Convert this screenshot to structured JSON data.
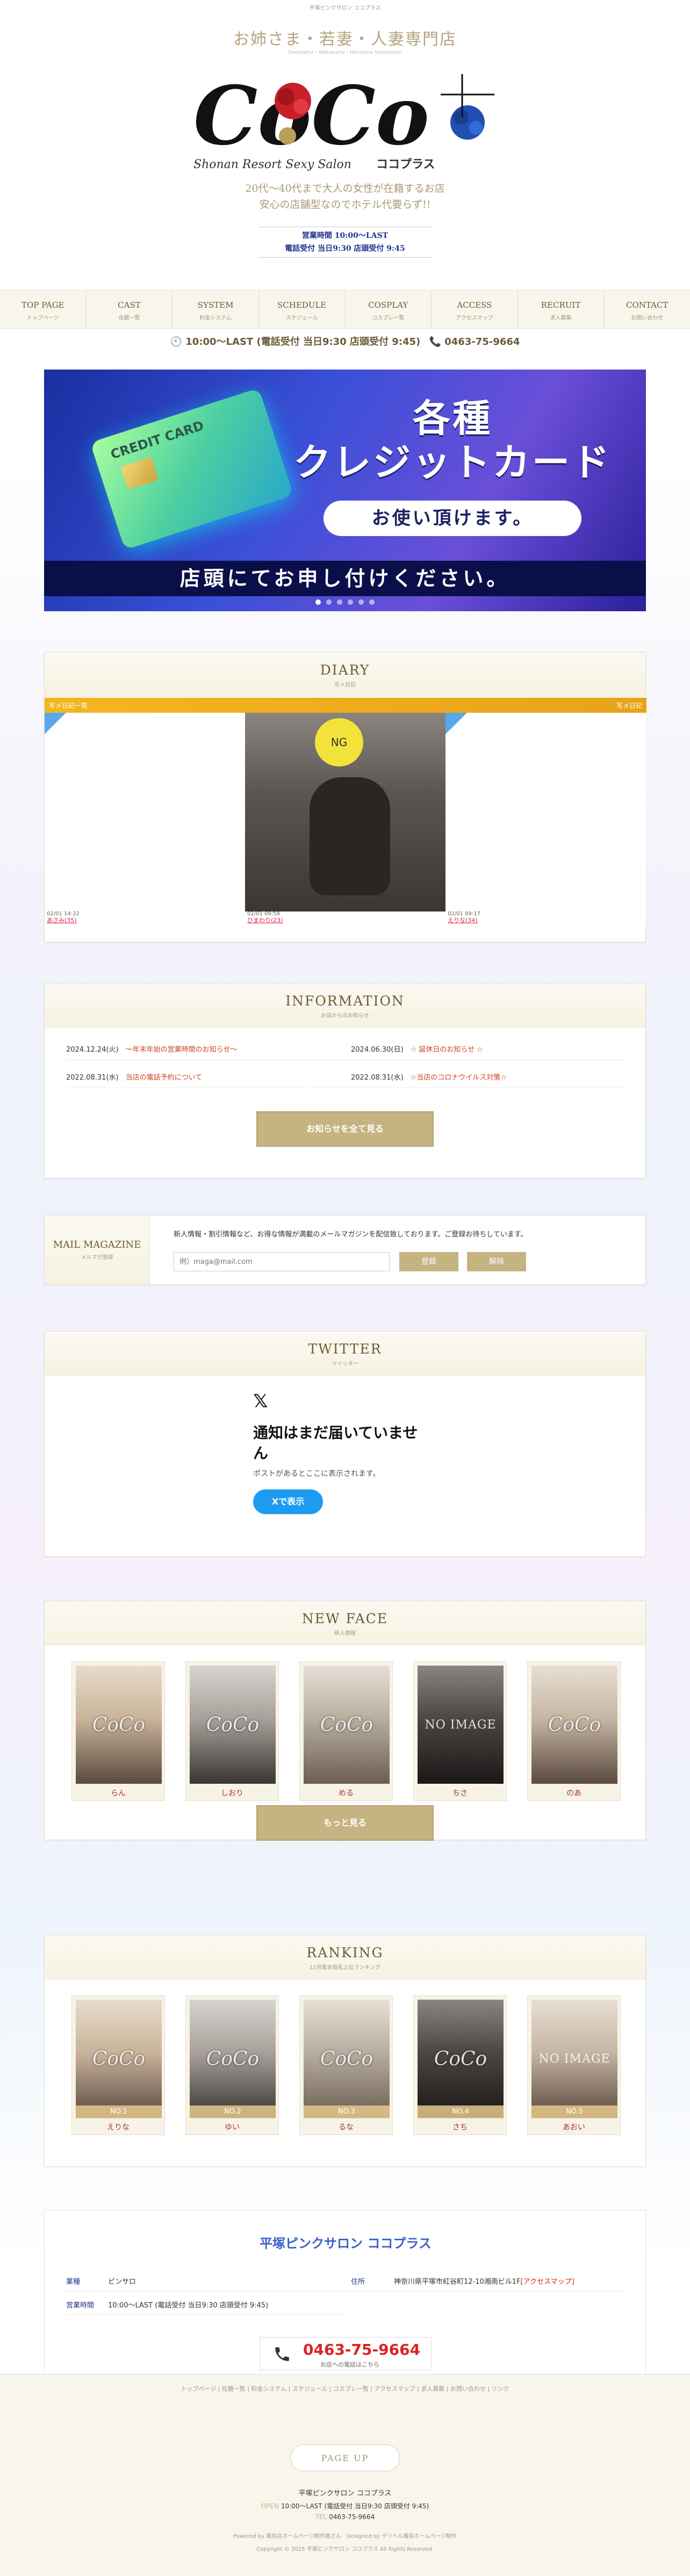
{
  "header": {
    "top_tag": "平塚ピンクサロン ココプラス",
    "tagline": "お姉さま・若妻・人妻専門店",
    "tag_small": "Oneesama・Wakazuma・Hitozuma Senmonten",
    "logo_text": "CoCo",
    "logo_plus": "+",
    "logo_sub_en": "Shonan Resort Sexy Salon",
    "logo_sub_jp": "ココプラス",
    "catch1": "20代～40代まで大人の女性が在籍するお店",
    "catch2": "安心の店舗型なのでホテル代要らず!!",
    "hours1": "営業時間 10:00～LAST",
    "hours2": "電話受付 当日9:30 店頭受付 9:45"
  },
  "nav": [
    {
      "en": "TOP PAGE",
      "jp": "トップページ"
    },
    {
      "en": "CAST",
      "jp": "在籍一覧"
    },
    {
      "en": "SYSTEM",
      "jp": "料金システム"
    },
    {
      "en": "SCHEDULE",
      "jp": "スケジュール"
    },
    {
      "en": "COSPLAY",
      "jp": "コスプレ一覧"
    },
    {
      "en": "ACCESS",
      "jp": "アクセスマップ"
    },
    {
      "en": "RECRUIT",
      "jp": "求人募集"
    },
    {
      "en": "CONTACT",
      "jp": "お問い合わせ"
    }
  ],
  "infobar": {
    "hours": "10:00～LAST (電話受付 当日9:30 店頭受付 9:45)",
    "tel": "0463-75-9664"
  },
  "banner": {
    "card_text": "CREDIT CARD",
    "title": "各種\nクレジットカード",
    "pill": "お使い頂けます。",
    "bottom": "店頭にてお申し付けください。",
    "dot_count": 6,
    "active_dot": 0
  },
  "diary": {
    "title_en": "DIARY",
    "title_jp": "写メ日記",
    "bar_label": "写メ日記一覧",
    "bar_right": "写メ日記",
    "entries": [
      {
        "date": "02/01 14:22",
        "name": "あさみ(35)"
      },
      {
        "date": "02/01 09:58",
        "name": "ひまわり(23)"
      },
      {
        "date": "02/01 09:17",
        "name": "えりな(34)"
      }
    ],
    "badge": "NG"
  },
  "information": {
    "title_en": "INFORMATION",
    "title_jp": "お店からのお知らせ",
    "items": [
      {
        "date": "2024.12.24(火)",
        "text": "〜年末年始の営業時間のお知らせ〜"
      },
      {
        "date": "2024.06.30(日)",
        "text": "☆ 誕休日のお知らせ ☆"
      },
      {
        "date": "2022.08.31(水)",
        "text": "当店の電話予約について"
      },
      {
        "date": "2022.08.31(水)",
        "text": "☆当店のコロナウイルス対策☆"
      }
    ],
    "more_button": "お知らせを全て見る"
  },
  "mail": {
    "title_en": "MAIL MAGAZINE",
    "title_jp": "メルマガ登録",
    "text": "新人情報・割引情報など、お得な情報が満載のメールマガジンを配信致しております。ご登録お待ちしています。",
    "placeholder": "例）maga@mail.com",
    "register": "登録",
    "cancel": "解除"
  },
  "twitter": {
    "title_en": "TWITTER",
    "title_jp": "ツイッター",
    "x_logo": "𝕏",
    "empty_title": "通知はまだ届いていません",
    "empty_sub": "ポストがあるとここに表示されます。",
    "button": "Xで表示"
  },
  "newface": {
    "title_en": "NEW FACE",
    "title_jp": "新人情報",
    "casts": [
      {
        "name": "らん",
        "noimage": false
      },
      {
        "name": "しおり",
        "noimage": false
      },
      {
        "name": "める",
        "noimage": false
      },
      {
        "name": "ちさ",
        "noimage": true
      },
      {
        "name": "のあ",
        "noimage": false
      }
    ],
    "more_button": "もっと見る",
    "overlay": "CoCo",
    "noimage_text": "NO IMAGE"
  },
  "ranking": {
    "title_en": "RANKING",
    "title_jp": "12月度本指名上位ランキング",
    "casts": [
      {
        "name": "えりな",
        "rank": "NO.1",
        "noimage": false
      },
      {
        "name": "ゆい",
        "rank": "NO.2",
        "noimage": false
      },
      {
        "name": "るな",
        "rank": "NO.3",
        "noimage": false
      },
      {
        "name": "さち",
        "rank": "NO.4",
        "noimage": false
      },
      {
        "name": "あおい",
        "rank": "NO.5",
        "noimage": true
      }
    ]
  },
  "shopinfo": {
    "title": "平塚ピンクサロン ココプラス",
    "type_label": "業種",
    "type_value": "ピンサロ",
    "addr_label": "住所",
    "addr_value": "神奈川県平塚市紅谷町12-10湘南ビル1F",
    "addr_link": "[アクセスマップ]",
    "hours_label": "営業時間",
    "hours_value": "10:00～LAST (電話受付 当日9:30 店頭受付 9:45)",
    "tel": "0463-75-9664",
    "tel_sub": "お店への電話はこちら"
  },
  "footer": {
    "links": "トップページ | 在籍一覧 | 料金システム | スケジュール | コスプレ一覧 | アクセスマップ | 求人募集 | お問い合わせ | リンク",
    "pageup": "PAGE UP",
    "name": "平塚ピンクサロン ココプラス",
    "open_label": "OPEN",
    "open": "10:00～LAST (電話受付 当日9:30 店頭受付 9:45)",
    "tel_label": "TEL",
    "tel": "0463-75-9664",
    "powered": "Powered by 風俗店ホームページ制作屋さん　Designed by デリヘル風俗ホームページ制作",
    "copyright": "Copyright © 2025 平塚ピンクサロン ココプラス All Rights Reserved."
  },
  "colors": {
    "gold": "#c5b482",
    "navy": "#22338a",
    "accent_red": "#d22",
    "brown": "#6e5a34"
  }
}
